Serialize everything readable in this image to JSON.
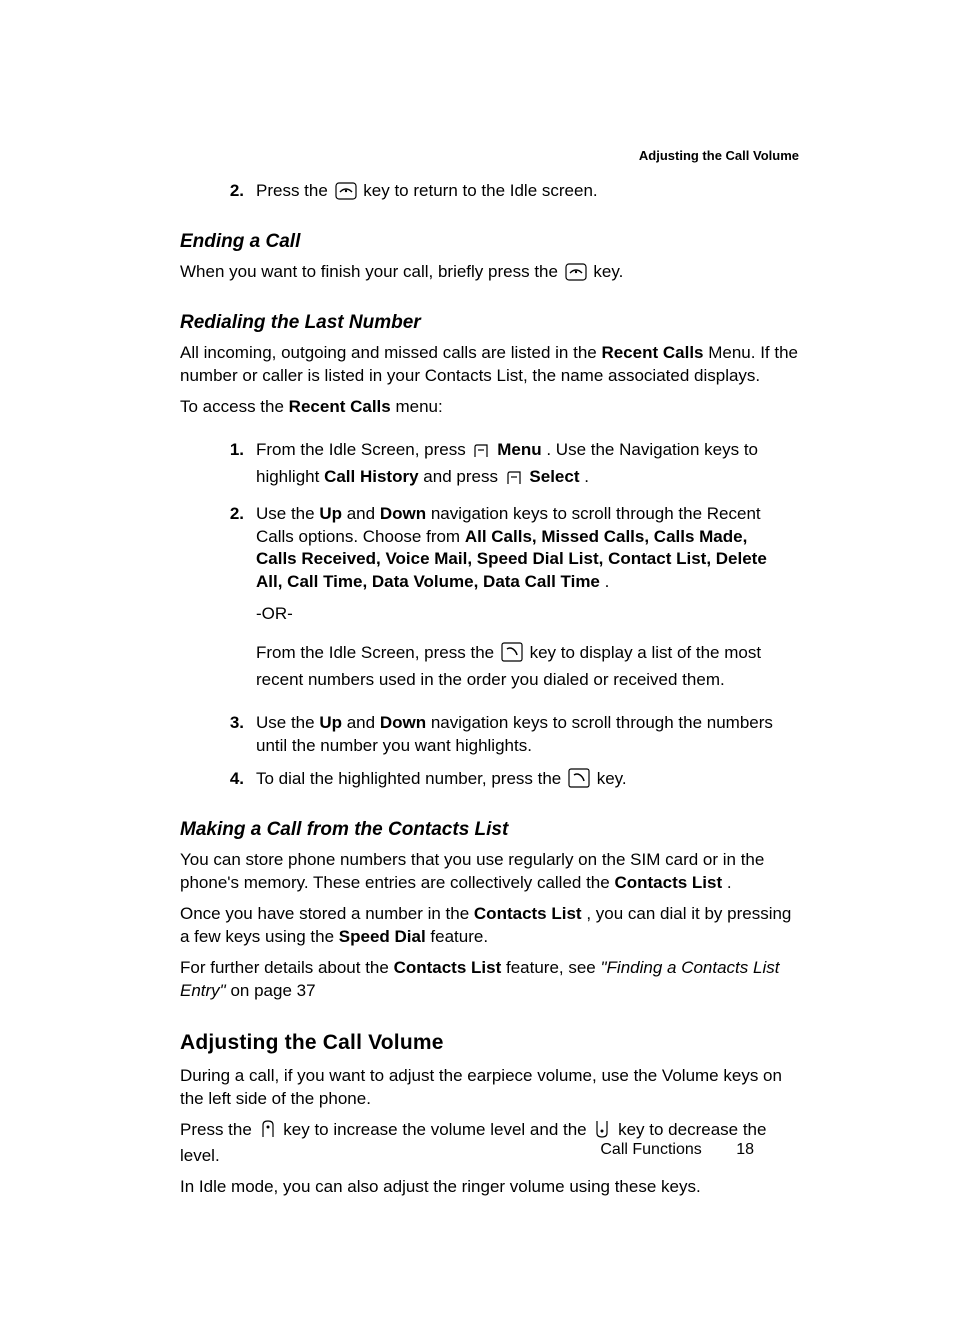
{
  "running_header": "Adjusting the Call Volume",
  "top_step": {
    "num": "2.",
    "pre": "Press the ",
    "post": " key to return to the Idle screen."
  },
  "ending": {
    "heading": "Ending a Call",
    "text_pre": "When you want to finish your call, briefly press the ",
    "text_post": " key."
  },
  "redial": {
    "heading": "Redialing the Last Number",
    "intro": "All incoming, outgoing and missed calls are listed in the ",
    "intro_b1": "Recent Calls",
    "intro_post": " Menu. If the number or caller is listed in your Contacts List, the name associated displays.",
    "access_pre": "To access the ",
    "access_b": "Recent Calls",
    "access_post": " menu:",
    "steps": {
      "s1": {
        "num": "1.",
        "t1": "From the Idle Screen, press ",
        "b1": "Menu",
        "t2": ". Use the Navigation keys to highlight ",
        "b2": "Call History",
        "t3": " and press ",
        "b3": "Select",
        "t4": "."
      },
      "s2": {
        "num": "2.",
        "t1": "Use the ",
        "b1": "Up",
        "t2": " and ",
        "b2": "Down",
        "t3": " navigation keys to scroll through the Recent Calls options. Choose from ",
        "list": "All Calls, Missed Calls, Calls Made, Calls Received, Voice Mail, Speed Dial List, Contact List, Delete All, Call Time, Data Volume, Data Call Time",
        "t4": "."
      },
      "or": "-OR-",
      "s2b_pre": "From the Idle Screen, press the ",
      "s2b_post": " key to display a list of the most recent numbers used in the order you dialed or received them.",
      "s3": {
        "num": "3.",
        "t1": "Use the ",
        "b1": "Up",
        "t2": " and ",
        "b2": "Down",
        "t3": " navigation keys to scroll through the numbers until the number you want highlights."
      },
      "s4": {
        "num": "4.",
        "t1": "To dial the highlighted number, press the ",
        "t2": " key."
      }
    }
  },
  "contacts": {
    "heading": "Making a Call from the Contacts List",
    "p1_pre": "You can store phone numbers that you use regularly on the SIM card or in the phone's memory. These entries are collectively called the ",
    "p1_b": "Contacts List",
    "p1_post": ".",
    "p2_pre": "Once you have stored a number in the ",
    "p2_b1": "Contacts List",
    "p2_mid": ", you can dial it by pressing a few keys using the ",
    "p2_b2": "Speed Dial",
    "p2_post": " feature.",
    "p3_pre": "For further details about the ",
    "p3_b": "Contacts List",
    "p3_mid": " feature, see ",
    "p3_i": "\"Finding a Contacts List Entry\"",
    "p3_post": "  on page 37"
  },
  "volume": {
    "heading": "Adjusting the Call Volume",
    "p1": "During a call, if you want to adjust the earpiece volume, use the Volume keys on the left side of the phone.",
    "p2_pre": "Press the ",
    "p2_mid": " key to increase the volume level and the ",
    "p2_post": " key to decrease the level.",
    "p3": "In Idle mode, you can also adjust the ringer volume using these keys."
  },
  "footer": {
    "section": "Call Functions",
    "page": "18"
  }
}
